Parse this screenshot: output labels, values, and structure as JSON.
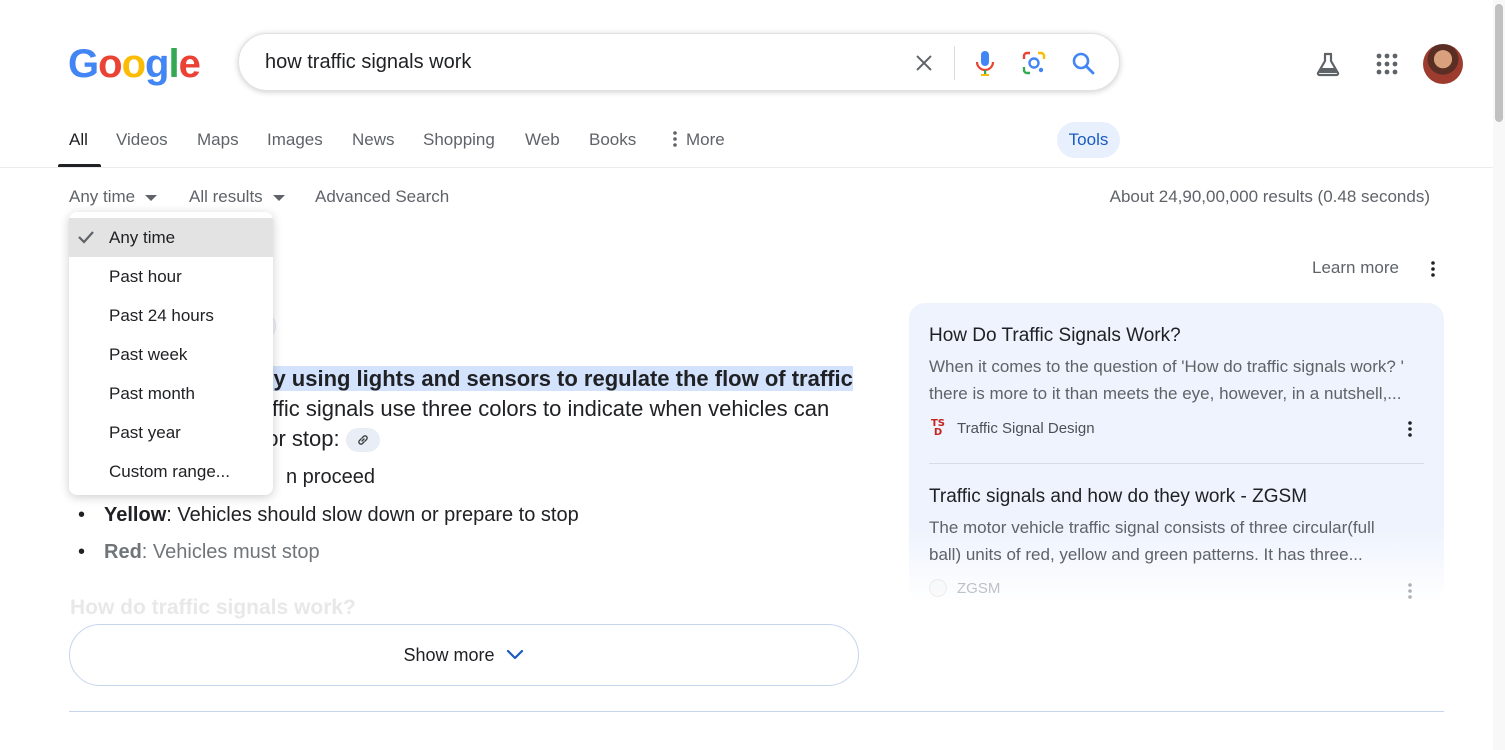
{
  "logo": {
    "letters": [
      "G",
      "o",
      "o",
      "g",
      "l",
      "e"
    ],
    "colors": [
      "#4285F4",
      "#EA4335",
      "#FBBC05",
      "#4285F4",
      "#34A853",
      "#EA4335"
    ]
  },
  "search": {
    "query": "how traffic signals work"
  },
  "header_icons": [
    "labs-flask-icon",
    "apps-grid-icon",
    "avatar"
  ],
  "tabs": [
    {
      "label": "All",
      "active": true
    },
    {
      "label": "Videos"
    },
    {
      "label": "Maps"
    },
    {
      "label": "Images"
    },
    {
      "label": "News"
    },
    {
      "label": "Shopping"
    },
    {
      "label": "Web"
    },
    {
      "label": "Books"
    },
    {
      "label": "More"
    }
  ],
  "tools_label": "Tools",
  "toolbar": {
    "time_filter": "Any time",
    "results_filter": "All results",
    "advanced_search": "Advanced Search",
    "stats": "About 24,90,00,000 results (0.48 seconds)"
  },
  "time_menu": {
    "selected": "Any time",
    "items": [
      "Any time",
      "Past hour",
      "Past 24 hours",
      "Past week",
      "Past month",
      "Past year",
      "Custom range..."
    ]
  },
  "answer": {
    "line1_highlight": "by using lights and sensors to regulate the flow of traffic",
    "line2": "ffic signals use three colors to indicate when vehicles can",
    "line3": ", or stop:",
    "bullet1_tail": "n proceed",
    "bullet2_label": "Yellow",
    "bullet2_text": ": Vehicles should slow down or prepare to stop",
    "bullet3_label": "Red",
    "bullet3_text": ": Vehicles must stop",
    "faded_question": "How do traffic signals work?"
  },
  "show_more": "Show more",
  "side": {
    "learn_more": "Learn more",
    "cards": [
      {
        "title": "How Do Traffic Signals Work?",
        "snippet1": "When it comes to the question of 'How do traffic signals work? '",
        "snippet2": "there is more to it than meets the eye, however, in a nutshell,...",
        "source": "Traffic Signal Design"
      },
      {
        "title": "Traffic signals and how do they work - ZGSM",
        "snippet1": "The motor vehicle traffic signal consists of three circular(full",
        "snippet2": "ball) units of red, yellow and green patterns. It has three...",
        "source": "ZGSM"
      }
    ]
  }
}
